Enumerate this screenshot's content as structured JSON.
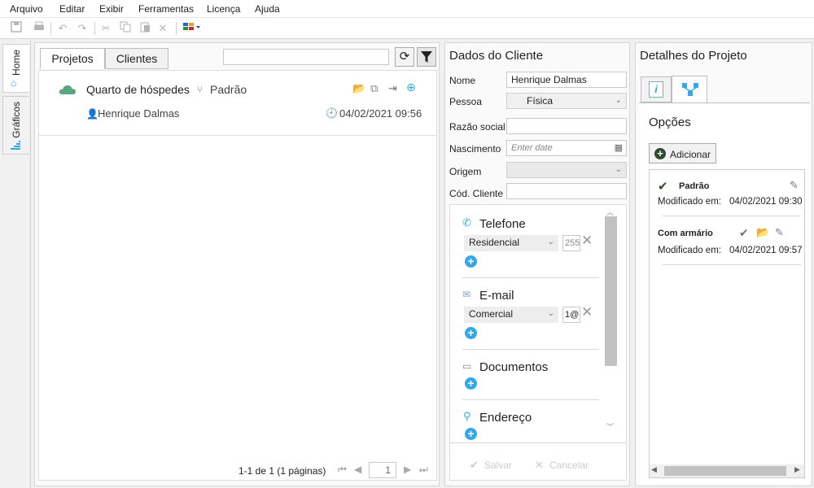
{
  "menu": [
    "Arquivo",
    "Editar",
    "Exibir",
    "Ferramentas",
    "Licença",
    "Ajuda"
  ],
  "sidebar": {
    "home_label": "Home",
    "graphs_label": "Gráficos"
  },
  "projects_panel": {
    "tabs": [
      "Projetos",
      "Clientes"
    ],
    "search_value": "",
    "project": {
      "name": "Quarto de hóspedes",
      "option": "Padrão",
      "client": "Henrique Dalmas",
      "datetime": "04/02/2021 09:56"
    },
    "pagination": {
      "summary": "1-1 de 1 (1 páginas)",
      "page": "1"
    }
  },
  "client_panel": {
    "title": "Dados do Cliente",
    "fields": {
      "nome_label": "Nome",
      "nome_value": "Henrique Dalmas",
      "pessoa_label": "Pessoa",
      "pessoa_value": "Física",
      "razao_label": "Razão social",
      "razao_value": "",
      "nascimento_label": "Nascimento",
      "nascimento_placeholder": "Enter date",
      "origem_label": "Origem",
      "origem_value": "",
      "cod_label": "Cód. Cliente",
      "cod_value": ""
    },
    "telefone": {
      "title": "Telefone",
      "type": "Residencial",
      "value": "255"
    },
    "email": {
      "title": "E-mail",
      "type": "Comercial",
      "value": "1@"
    },
    "documentos": {
      "title": "Documentos"
    },
    "endereco": {
      "title": "Endereço"
    },
    "actions": {
      "save": "Salvar",
      "cancel": "Cancelar"
    }
  },
  "project_details": {
    "title": "Detalhes do Projeto",
    "options_title": "Opções",
    "add_label": "Adicionar",
    "options": [
      {
        "name": "Padrão",
        "modified_label": "Modificado em:",
        "modified": "04/02/2021 09:30"
      },
      {
        "name": "Com armário",
        "modified_label": "Modificado em:",
        "modified": "04/02/2021 09:57"
      }
    ]
  },
  "colors": {
    "accent_blue": "#32a7ea",
    "cloud_green": "#5aa57e",
    "check_dark": "#2e4a2e"
  }
}
